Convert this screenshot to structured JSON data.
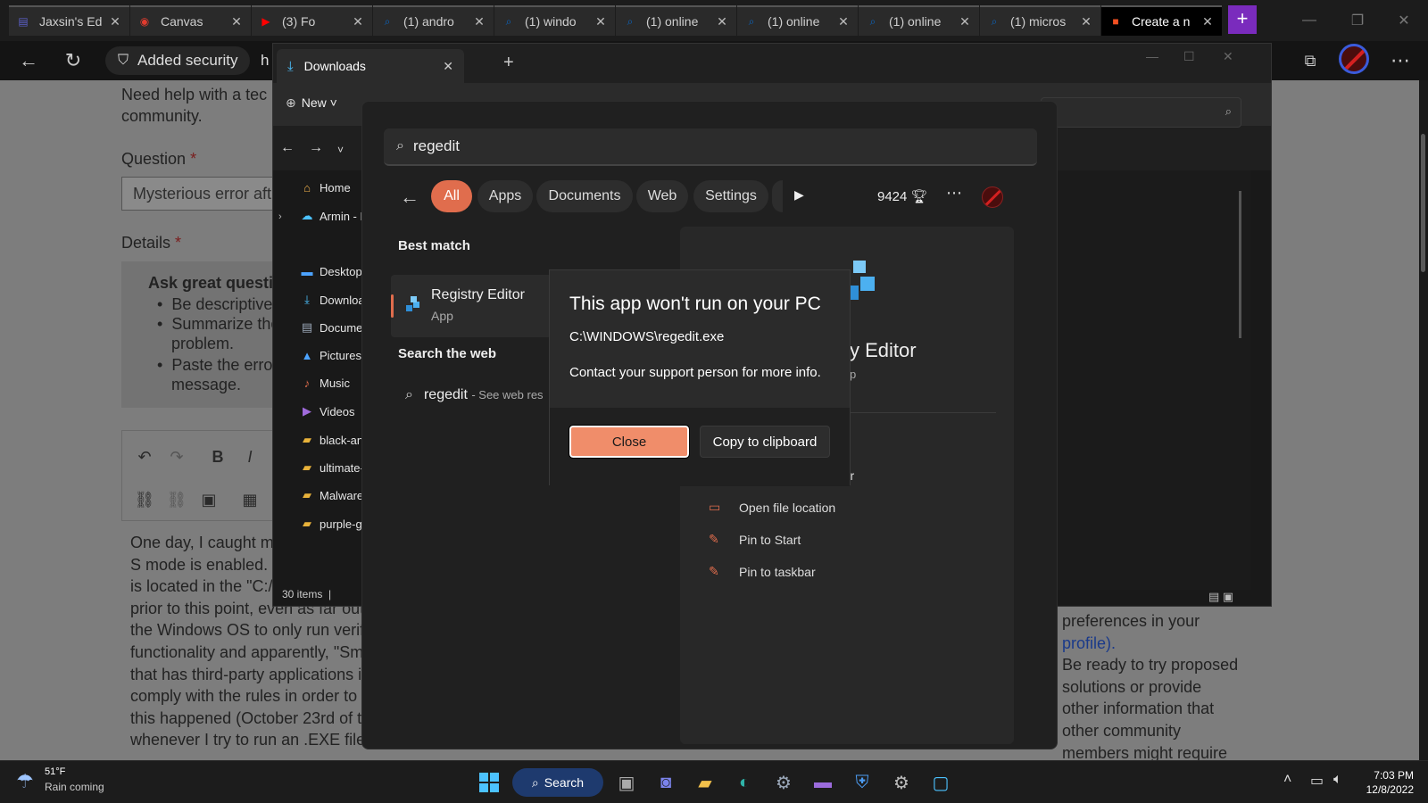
{
  "browser": {
    "tabs": [
      {
        "label": "Jaxsin's Ed",
        "favicon_color": "#5b5fc7",
        "favicon": "▤"
      },
      {
        "label": "Canvas",
        "favicon_color": "#e13b2e",
        "favicon": "◉"
      },
      {
        "label": "(3) Fo",
        "favicon_color": "#ff0000",
        "favicon": "▶"
      },
      {
        "label": "(1) andro",
        "favicon_color": "#0a66c2",
        "favicon": "⌕"
      },
      {
        "label": "(1) windo",
        "favicon_color": "#0a66c2",
        "favicon": "⌕"
      },
      {
        "label": "(1) online",
        "favicon_color": "#0a66c2",
        "favicon": "⌕"
      },
      {
        "label": "(1) online",
        "favicon_color": "#0a66c2",
        "favicon": "⌕"
      },
      {
        "label": "(1) online",
        "favicon_color": "#0a66c2",
        "favicon": "⌕"
      },
      {
        "label": "(1) micros",
        "favicon_color": "#0a66c2",
        "favicon": "⌕"
      },
      {
        "label": "Create a n",
        "favicon_color": "#f25022",
        "favicon": "■",
        "active": true
      }
    ],
    "address_chip": "Added security",
    "address_tail": "h"
  },
  "webpage": {
    "intro_line1": "Need help with a tec",
    "intro_line2": "community.",
    "question_label": "Question",
    "required_mark": "*",
    "question_value": "Mysterious error aft",
    "details_label": "Details",
    "tips_title": "Ask great questi",
    "tips": [
      "Be descriptive.",
      "Summarize the",
      "problem.",
      "Paste the error",
      "message."
    ],
    "body_lines": [
      "One day, I caught m",
      "S mode is enabled. T",
      "is located in the \"C:/",
      "prior to this point, even as far out",
      "the Windows OS to only run verifi",
      "functionality and apparently, \"Sma",
      "that has third-party applications in",
      "comply with the rules in order to p",
      "this happened (October 23rd of th",
      "whenever I try to run an .EXE file (even \"ChromeSetup.exe\", or basically, trusted and signed .EXE files), I get this"
    ],
    "right_lines": [
      "preferences in your",
      "profile).",
      "Be ready to try proposed",
      "solutions or provide",
      "other information that",
      "other community",
      "members might require"
    ]
  },
  "explorer": {
    "tab_title": "Downloads",
    "new_label": "New",
    "sidebar": [
      {
        "label": "Home",
        "icon": "⌂",
        "color": "#f2b24b"
      },
      {
        "label": "Armin - P",
        "icon": "☁",
        "color": "#4cc2ff"
      },
      {
        "label": "Desktop",
        "icon": "▬",
        "color": "#4ca3ff"
      },
      {
        "label": "Downloa",
        "icon": "⤓",
        "color": "#4cc2ff"
      },
      {
        "label": "Documen",
        "icon": "▤",
        "color": "#9aa7b8"
      },
      {
        "label": "Pictures",
        "icon": "▲",
        "color": "#4ca3ff"
      },
      {
        "label": "Music",
        "icon": "♪",
        "color": "#e06d4d"
      },
      {
        "label": "Videos",
        "icon": "▶",
        "color": "#a06bdc"
      },
      {
        "label": "black-anc",
        "icon": "▰",
        "color": "#e8b23a"
      },
      {
        "label": "ultimate-",
        "icon": "▰",
        "color": "#e8b23a"
      },
      {
        "label": "Malware",
        "icon": "▰",
        "color": "#e8b23a"
      },
      {
        "label": "purple-gl",
        "icon": "▰",
        "color": "#e8b23a"
      }
    ],
    "status": "30 items"
  },
  "search": {
    "query": "regedit",
    "chips": [
      "All",
      "Apps",
      "Documents",
      "Web",
      "Settings"
    ],
    "points": "9424",
    "best_match_heading": "Best match",
    "best_match_name": "Registry Editor",
    "best_match_kind": "App",
    "web_heading": "Search the web",
    "web_query": "regedit",
    "web_sub": "- See web res",
    "detail_name": "y Editor",
    "detail_kind": "p",
    "actions": [
      {
        "label": "Run as administrator",
        "icon": "⛨"
      },
      {
        "label": "Open file location",
        "icon": "▭"
      },
      {
        "label": "Pin to Start",
        "icon": "✎"
      },
      {
        "label": "Pin to taskbar",
        "icon": "✎"
      }
    ]
  },
  "dialog": {
    "title": "This app won't run on your PC",
    "path": "C:\\WINDOWS\\regedit.exe",
    "message": "Contact your support person for more info.",
    "close_label": "Close",
    "copy_label": "Copy to clipboard"
  },
  "taskbar": {
    "temperature": "51°F",
    "weather": "Rain coming",
    "search_label": "Search",
    "time": "7:03 PM",
    "date": "12/8/2022"
  }
}
